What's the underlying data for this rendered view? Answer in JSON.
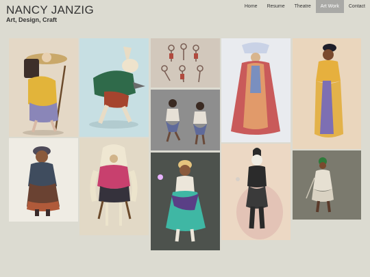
{
  "site": {
    "title": "NANCY JANZIG",
    "tagline": "Art, Design, Craft"
  },
  "nav": {
    "items": [
      {
        "label": "Home"
      },
      {
        "label": "Resume"
      },
      {
        "label": "Theatre"
      },
      {
        "label": "Art Work",
        "active": true
      },
      {
        "label": "Contact"
      }
    ]
  },
  "gallery": {
    "tiles": [
      {
        "subject": "traveler-with-staff-and-mask",
        "background": "#e4d8c6"
      },
      {
        "subject": "woman-in-dark-dress",
        "background": "#efece4"
      },
      {
        "subject": "hare-in-green-coat",
        "background": "#c7dfe3"
      },
      {
        "subject": "owl-figure-in-pink-top",
        "background": "#e2d9c6"
      },
      {
        "subject": "group-sketch",
        "background": "#d2c8bc"
      },
      {
        "subject": "two-dancers",
        "background": "#8e8e8e"
      },
      {
        "subject": "woman-in-teal-dress",
        "background": "#4d524d"
      },
      {
        "subject": "robed-queen",
        "background": "#e9ebef"
      },
      {
        "subject": "skeleton-figure-in-black",
        "background": "#ecd8c4"
      },
      {
        "subject": "woman-in-gold-robe",
        "background": "#ead6bd"
      },
      {
        "subject": "man-in-tunic",
        "background": "#7b7a6e"
      }
    ]
  }
}
